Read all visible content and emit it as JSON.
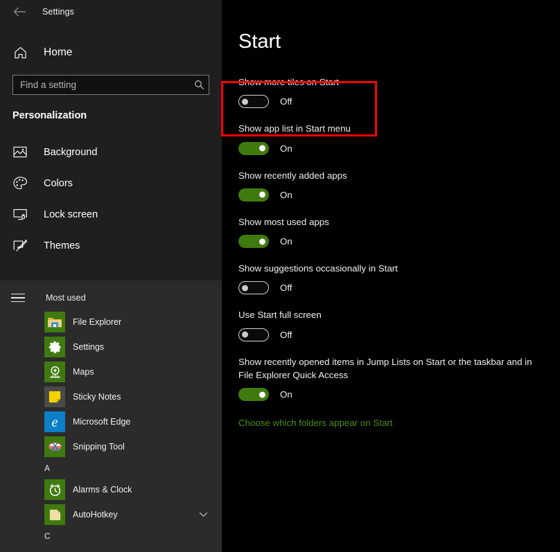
{
  "window": {
    "title": "Settings",
    "back_icon": "back-arrow-icon"
  },
  "sidebar": {
    "home": {
      "label": "Home",
      "icon": "home-icon"
    },
    "search": {
      "placeholder": "Find a setting",
      "value": "",
      "icon": "search-icon"
    },
    "category": "Personalization",
    "items": [
      {
        "label": "Background",
        "icon": "picture-icon"
      },
      {
        "label": "Colors",
        "icon": "palette-icon"
      },
      {
        "label": "Lock screen",
        "icon": "lock-screen-icon"
      },
      {
        "label": "Themes",
        "icon": "brush-icon"
      }
    ]
  },
  "start_menu": {
    "menu_icon": "hamburger-icon",
    "most_used_label": "Most used",
    "most_used": [
      {
        "name": "File Explorer",
        "icon": "file-explorer-icon",
        "tile_color": "#3e7a0f"
      },
      {
        "name": "Settings",
        "icon": "gear-icon",
        "tile_color": "#3e7a0f"
      },
      {
        "name": "Maps",
        "icon": "maps-pin-icon",
        "tile_color": "#3e7a0f"
      },
      {
        "name": "Sticky Notes",
        "icon": "sticky-note-icon",
        "tile_color": "#4a4a4a"
      },
      {
        "name": "Microsoft Edge",
        "icon": "edge-icon",
        "tile_color": "#0d7ec8"
      },
      {
        "name": "Snipping Tool",
        "icon": "scissors-icon",
        "tile_color": "#3e7a0f"
      }
    ],
    "groups": [
      {
        "letter": "A",
        "apps": [
          {
            "name": "Alarms & Clock",
            "icon": "alarm-clock-icon",
            "tile_color": "#3e7a0f",
            "expandable": false
          },
          {
            "name": "AutoHotkey",
            "icon": "folder-icon",
            "tile_color": "#3e7a0f",
            "expandable": true,
            "chevron": "chevron-down-icon"
          }
        ]
      },
      {
        "letter": "C",
        "apps": []
      }
    ]
  },
  "main": {
    "title": "Start",
    "settings": [
      {
        "desc": "Show more tiles on Start",
        "state": "Off",
        "on": false
      },
      {
        "desc": "Show app list in Start menu",
        "state": "On",
        "on": true,
        "highlighted": true
      },
      {
        "desc": "Show recently added apps",
        "state": "On",
        "on": true
      },
      {
        "desc": "Show most used apps",
        "state": "On",
        "on": true
      },
      {
        "desc": "Show suggestions occasionally in Start",
        "state": "Off",
        "on": false
      },
      {
        "desc": "Use Start full screen",
        "state": "Off",
        "on": false
      },
      {
        "desc": "Show recently opened items in Jump Lists on Start or the taskbar and in File Explorer Quick Access",
        "state": "On",
        "on": true
      }
    ],
    "link": "Choose which folders appear on Start"
  },
  "colors": {
    "accent_green": "#3f7a0e",
    "link_green": "#4a8f10",
    "highlight_red": "#fe0000",
    "sidebar_bg": "#1f1f1f",
    "startmenu_bg": "#2b2b2b",
    "content_bg": "#000000"
  }
}
